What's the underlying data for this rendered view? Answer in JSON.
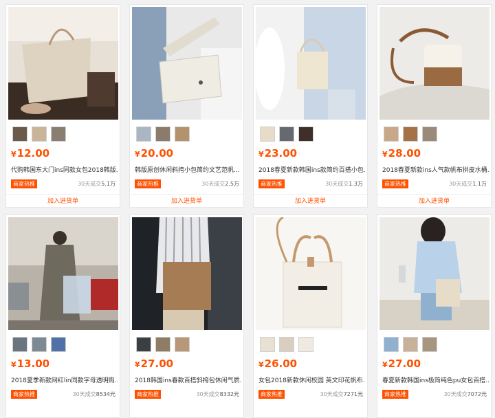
{
  "products": [
    {
      "price": "12.00",
      "title": "代购韩国东大门ins同款女包2018韩版...",
      "badge": "商家热推",
      "sales_prefix": "30天成交",
      "sales": "5.1万",
      "add_label": "加入进货单",
      "thumb_colors": [
        "#6b5a4a",
        "#c9b49a",
        "#8a7e72"
      ]
    },
    {
      "price": "20.00",
      "title": "韩版原创休闲斜挎小包简约文艺范帆...",
      "badge": "商家热推",
      "sales_prefix": "30天成交",
      "sales": "2.5万",
      "add_label": "加入进货单",
      "thumb_colors": [
        "#aab6c2",
        "#8b7b6a",
        "#b5926e"
      ]
    },
    {
      "price": "23.00",
      "title": "2018春夏新款韩国ins款简约百搭小包...",
      "badge": "商家热推",
      "sales_prefix": "30天成交",
      "sales": "1.3万",
      "add_label": "加入进货单",
      "thumb_colors": [
        "#e8dcc8",
        "#666a70",
        "#3e2f2a"
      ]
    },
    {
      "price": "28.00",
      "title": "2018春夏新款ins人气款帆布拼皮水桶...",
      "badge": "商家热推",
      "sales_prefix": "30天成交",
      "sales": "1.1万",
      "add_label": "加入进货单",
      "thumb_colors": [
        "#c8a888",
        "#a57248",
        "#9a8a78"
      ]
    },
    {
      "price": "13.00",
      "title": "2018夏季新款网红lin同款字母透明购...",
      "badge": "商家热推",
      "sales_prefix": "30天成交",
      "sales": "8534元",
      "add_label": "",
      "thumb_colors": [
        "#6b7580",
        "#7d8a94",
        "#5072a8"
      ]
    },
    {
      "price": "27.00",
      "title": "2018韩国ins春款百搭斜挎包休闲气质...",
      "badge": "商家热推",
      "sales_prefix": "30天成交",
      "sales": "8332元",
      "add_label": "",
      "thumb_colors": [
        "#3b3f42",
        "#8e7c66",
        "#b89878"
      ]
    },
    {
      "price": "26.00",
      "title": "女包2018新款休闲校园 英文印花帆布...",
      "badge": "商家热推",
      "sales_prefix": "30天成交",
      "sales": "7271元",
      "add_label": "",
      "thumb_colors": [
        "#e8e0d2",
        "#d9cfc0",
        "#efe9df"
      ]
    },
    {
      "price": "27.00",
      "title": "春夏新款韩国ins极简纯色pu女包百搭...",
      "badge": "商家热推",
      "sales_prefix": "30天成交",
      "sales": "7072元",
      "add_label": "",
      "thumb_colors": [
        "#8fb0cf",
        "#c7b199",
        "#a7967f"
      ]
    }
  ]
}
